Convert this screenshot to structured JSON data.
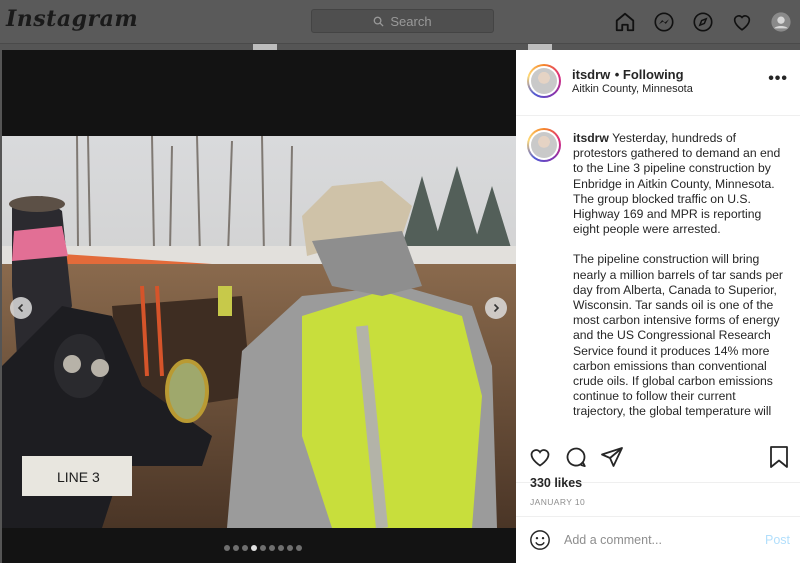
{
  "topbar": {
    "logo": "Instagram",
    "search_placeholder": "Search",
    "nav_icons": [
      "home-icon",
      "messenger-icon",
      "explore-icon",
      "heart-icon",
      "profile-icon"
    ]
  },
  "post": {
    "username": "itsdrw",
    "follow_status": "• Following",
    "location": "Aitkin County, Minnesota",
    "photo_sign_text": "LINE 3",
    "carousel": {
      "total": 9,
      "active_index": 3
    },
    "caption": [
      "Yesterday, hundreds of protestors gathered to demand an end to the Line 3 pipeline construction by Enbridge in Aitkin County, Minnesota. The group blocked traffic on U.S. Highway 169 and MPR is reporting eight people were arrested.",
      "The pipeline construction will bring nearly a million barrels of tar sands per day from Alberta, Canada to Superior, Wisconsin. Tar sands oil is one of the most carbon intensive forms of energy and the US Congressional Research Service found it produces 14% more carbon emissions than conventional crude oils. If global carbon emissions continue to follow their current trajectory, the global temperature will"
    ],
    "likes": "330 likes",
    "date": "JANUARY 10",
    "comment_placeholder": "Add a comment...",
    "post_button": "Post"
  },
  "colors": {
    "accent_post": "#b2dffc",
    "text_primary": "#262626",
    "text_secondary": "#8e8e8e"
  }
}
